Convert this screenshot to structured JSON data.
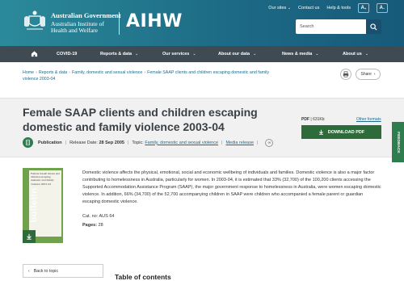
{
  "header": {
    "gov_line1": "Australian Government",
    "gov_line2": "Australian Institute of",
    "gov_line3": "Health and Welfare",
    "logo_text": "AIHW",
    "utility": {
      "our_sites": "Our sites",
      "contact_us": "Contact us",
      "help_tools": "Help & tools",
      "text_larger": "A",
      "text_smaller": "A"
    },
    "search_placeholder": "Search"
  },
  "nav": {
    "items": [
      {
        "label": "COVID-19"
      },
      {
        "label": "Reports & data"
      },
      {
        "label": "Our services"
      },
      {
        "label": "About our data"
      },
      {
        "label": "News & media"
      },
      {
        "label": "About us"
      }
    ]
  },
  "breadcrumb": {
    "items": [
      "Home",
      "Reports & data",
      "Family, domestic and sexual violence",
      "Female SAAP clients and children escaping domestic and family violence 2003-04"
    ]
  },
  "actions": {
    "share_label": "Share"
  },
  "publication": {
    "title": "Female SAAP clients and children escaping domestic and family violence 2003-04",
    "type": "Publication",
    "release_label": "Release Date:",
    "release_date": "28 Sep 2005",
    "topic_label": "Topic:",
    "topic": "Family, domestic and sexual violence",
    "media_release": "Media release",
    "pdf_label": "PDF",
    "pdf_size": "631Kb",
    "other_formats": "Other formats",
    "download_label": "DOWNLOAD PDF",
    "cover_title": "Female SAAP clients and children escaping domestic and family violence 2003–04",
    "cover_series": "bulletin",
    "description": "Domestic violence affects the physical, emotional, social and economic wellbeing of individuals and families. Domestic violence is also a major factor contributing to homelessness in Australia, particularly for women. In 2003-04, it is estimated that 33% (32,700) of the 100,200 clients accessing the Supported Accommodation Assistance Program (SAAP), the major government response to homelessness in Australia, were women escaping domestic violence. In addition, 66% (34,700) of the 52,700 accompanying children in SAAP were children who accompanied a female parent or guardian escaping domestic violence.",
    "cat_label": "Cat. no:",
    "cat_no": "AUS 64",
    "pages_label": "Pages:",
    "pages": "28"
  },
  "feedback_label": "FEEDBACK",
  "sidebar": {
    "back_to_topic": "Back to topic"
  },
  "toc_heading": "Table of contents",
  "colors": {
    "header_gradient_start": "#2b8a9a",
    "header_gradient_end": "#175a7a",
    "nav_bg": "#3f4a52",
    "accent_green": "#2e6b3a",
    "link": "#1b6b8e"
  }
}
